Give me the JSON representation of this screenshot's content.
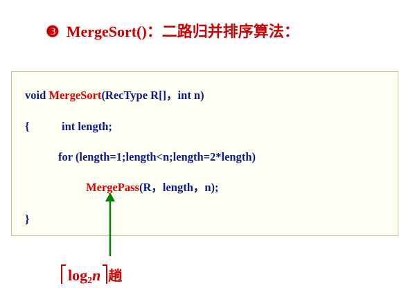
{
  "heading": {
    "bullet": "❸",
    "func": "MergeSort()",
    "colon1": "：",
    "desc": "二路归并排序算法",
    "colon2": "："
  },
  "code": {
    "line1": {
      "a": "void ",
      "b": "MergeSort",
      "c": "(RecType R[]，int n)"
    },
    "line2": {
      "brace": "{",
      "text": "int length;"
    },
    "line3": {
      "text": "for (length=1;length<n;length=2*length)"
    },
    "line4": {
      "a": "MergePass",
      "b": "(R，length，n);"
    },
    "line5": {
      "brace": "}"
    }
  },
  "annotation": {
    "log": "log",
    "base": "2",
    "var": "n",
    "suffix": "趟"
  },
  "colors": {
    "heading": "#cc0000",
    "code_text": "#0a1a8c",
    "code_highlight": "#e00000",
    "arrow": "#008000",
    "box_border": "#b8cc8a",
    "box_bg": "#fffff4"
  }
}
